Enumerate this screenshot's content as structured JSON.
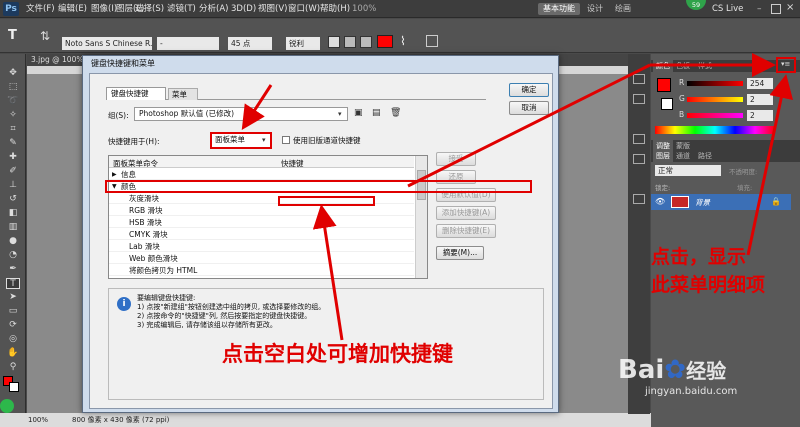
{
  "app": {
    "logo": "Ps",
    "menus": [
      "文件(F)",
      "编辑(E)",
      "图像(I)",
      "图层(L)",
      "选择(S)",
      "滤镜(T)",
      "分析(A)",
      "3D(D)",
      "视图(V)",
      "窗口(W)",
      "帮助(H)"
    ],
    "zoom": "100%",
    "workspace_active": "基本功能",
    "workspace_items": [
      "设计",
      "绘画"
    ],
    "cslive": "CS Live",
    "badge": "59"
  },
  "options": {
    "font_family": "Noto Sans S Chinese R...",
    "font_style": "-",
    "font_size": "45 点",
    "anti_alias": "锐利",
    "tool_icon": "T"
  },
  "document": {
    "tab": "3.jpg @ 100%(RG",
    "status_zoom": "100%",
    "status_info": "800 像素 x 430 像素 (72 ppi)"
  },
  "panels": {
    "color_tabs": [
      "颜色",
      "色板",
      "样式"
    ],
    "R": "254",
    "G": "2",
    "B": "2",
    "layers_tabs": [
      "图层",
      "通道",
      "路径"
    ],
    "blend": "正常",
    "opacity_label": "不透明度:",
    "lock_label": "锁定:",
    "fill_label": "填充:",
    "layer_name": "背景",
    "adjust_tabs": [
      "调整",
      "蒙版"
    ]
  },
  "dialog": {
    "title": "键盘快捷键和菜单",
    "tabs": [
      "键盘快捷键",
      "菜单"
    ],
    "set_label": "组(S):",
    "set_value": "Photoshop 默认值 (已修改)",
    "shortcuts_for_label": "快捷键用于(H):",
    "shortcuts_for_value": "面板菜单",
    "legacy_checkbox": "使用旧版通道快捷键",
    "col_command": "面板菜单命令",
    "col_shortcut": "快捷键",
    "rows": [
      {
        "label": "信息",
        "indent": 0,
        "arrow": "▶"
      },
      {
        "label": "颜色",
        "indent": 0,
        "arrow": "▼"
      },
      {
        "label": "灰度滑块",
        "indent": 1
      },
      {
        "label": "RGB 滑块",
        "indent": 1
      },
      {
        "label": "HSB 滑块",
        "indent": 1
      },
      {
        "label": "CMYK 滑块",
        "indent": 1
      },
      {
        "label": "Lab 滑块",
        "indent": 1
      },
      {
        "label": "Web 颜色滑块",
        "indent": 1
      },
      {
        "label": "将颜色拷贝为 HTML",
        "indent": 1
      }
    ],
    "buttons": {
      "ok": "确定",
      "cancel": "取消",
      "accept": "接受",
      "undo": "还原",
      "use_default": "使用默认值(D)",
      "add": "添加快捷键(A)",
      "delete": "删除快捷键(E)",
      "summary": "摘要(M)..."
    },
    "info_lines": [
      "要编辑键盘快捷键:",
      "1) 点按\"新建组\"按钮创建选中组的拷贝, 或选择要修改的组。",
      "2) 点按命令的\"快捷键\"列, 然后按要指定的键盘快捷键。",
      "3) 完成编辑后, 请存储该组以存储所有更改。"
    ]
  },
  "annotations": {
    "right": [
      "点击，显示",
      "此菜单明细项"
    ],
    "bottom": "点击空白处可增加快捷键"
  },
  "watermark": {
    "brand": "Bai",
    "brand2": "经验",
    "url": "jingyan.baidu.com"
  },
  "colors": {
    "accent": "#e00000",
    "fg_swatch": "#fe0202"
  }
}
